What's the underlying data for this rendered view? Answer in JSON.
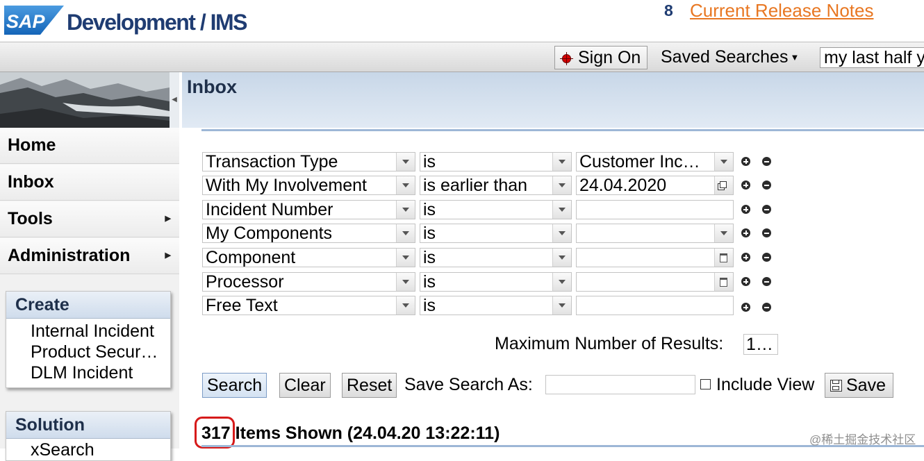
{
  "header": {
    "logo_text": "SAP",
    "app_title": "Development / IMS",
    "notes_count": "8",
    "notes_link": "Current Release Notes"
  },
  "toolbar": {
    "sign_on": "Sign On",
    "saved_searches": "Saved Searches",
    "saved_search_value": "my last half y"
  },
  "sidebar": {
    "nav": [
      {
        "label": "Home",
        "submenu": false
      },
      {
        "label": "Inbox",
        "submenu": false
      },
      {
        "label": "Tools",
        "submenu": true
      },
      {
        "label": "Administration",
        "submenu": true
      }
    ],
    "create": {
      "title": "Create",
      "items": [
        "Internal Incident",
        "Product Secur…",
        "DLM Incident"
      ]
    },
    "solution": {
      "title": "Solution",
      "items": [
        "xSearch"
      ]
    }
  },
  "main": {
    "title": "Inbox",
    "criteria": [
      {
        "field": "Transaction Type",
        "operator": "is",
        "value": "Customer Inc…",
        "value_widget": "dropdown"
      },
      {
        "field": "With My Involvement",
        "operator": "is earlier than",
        "value": "24.04.2020",
        "value_widget": "date"
      },
      {
        "field": "Incident Number",
        "operator": "is",
        "value": "",
        "value_widget": "text"
      },
      {
        "field": "My Components",
        "operator": "is",
        "value": "",
        "value_widget": "dropdown"
      },
      {
        "field": "Component",
        "operator": "is",
        "value": "",
        "value_widget": "picker"
      },
      {
        "field": "Processor",
        "operator": "is",
        "value": "",
        "value_widget": "picker"
      },
      {
        "field": "Free Text",
        "operator": "is",
        "value": "",
        "value_widget": "text"
      }
    ],
    "max_results_label": "Maximum Number of Results:",
    "max_results_value": "1…",
    "buttons": {
      "search": "Search",
      "clear": "Clear",
      "reset": "Reset",
      "save": "Save"
    },
    "save_search_label": "Save Search As:",
    "include_view_label": "Include View",
    "include_view_checked": false,
    "results": {
      "count": "317",
      "text": "Items Shown (24.04.20 13:22:11)"
    }
  },
  "watermark": "@稀土掘金技术社区",
  "colors": {
    "brand_blue": "#1f3c72",
    "link_orange": "#e87722",
    "highlight_red": "#d61a1a",
    "panel_blue": "#c8d7e8"
  }
}
